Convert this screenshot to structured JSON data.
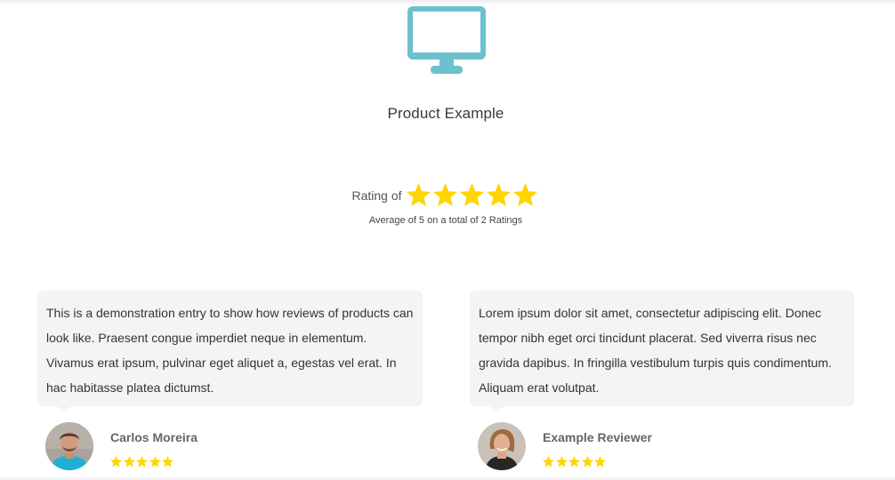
{
  "product": {
    "icon": "monitor-icon",
    "title": "Product Example",
    "icon_color": "#6cc1cc"
  },
  "rating": {
    "label": "Rating of",
    "stars": 5,
    "max_stars": 5,
    "average_text": "Average of 5 on a total of 2 Ratings",
    "star_color": "#ffd600"
  },
  "reviews": [
    {
      "text": "This is a demonstration entry to show how reviews of products can look like. Praesent congue imperdiet neque in elementum. Vivamus erat ipsum, pulvinar eget aliquet a, egestas vel erat. In hac habitasse platea dictumst.",
      "reviewer": "Carlos Moreira",
      "stars": 5
    },
    {
      "text": "Lorem ipsum dolor sit amet, consectetur adipiscing elit. Donec tempor nibh eget orci tincidunt placerat. Sed viverra risus nec gravida dapibus. In fringilla vestibulum turpis quis condimentum. Aliquam erat volutpat.",
      "reviewer": "Example Reviewer",
      "stars": 5
    }
  ]
}
